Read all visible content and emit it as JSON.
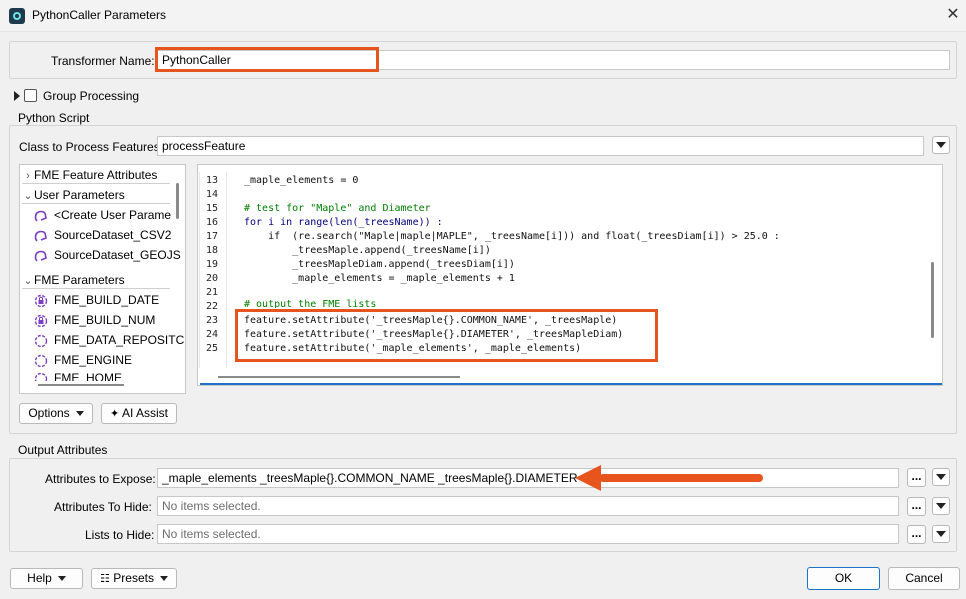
{
  "window": {
    "title": "PythonCaller Parameters"
  },
  "transformer": {
    "label": "Transformer Name:",
    "value": "PythonCaller"
  },
  "group_processing": {
    "label": "Group Processing",
    "checked": false
  },
  "python_script": {
    "title": "Python Script",
    "class_label": "Class to Process Features:",
    "class_value": "processFeature",
    "tree": {
      "sections": [
        {
          "label": "FME Feature Attributes",
          "expanded": false
        },
        {
          "label": "User Parameters",
          "expanded": true,
          "items": [
            "<Create User Parame",
            "SourceDataset_CSV2",
            "SourceDataset_GEOJS"
          ]
        },
        {
          "label": "FME Parameters",
          "expanded": true,
          "items": [
            "FME_BUILD_DATE",
            "FME_BUILD_NUM",
            "FME_DATA_REPOSITC",
            "FME_ENGINE",
            "FME_HOME"
          ]
        }
      ]
    },
    "code": {
      "lines": [
        {
          "n": "13",
          "text": "_maple_elements = 0"
        },
        {
          "n": "14",
          "text": ""
        },
        {
          "n": "15",
          "text": "# test for \"Maple\" and Diameter"
        },
        {
          "n": "16",
          "text": "for i in range(len(_treesName)) :"
        },
        {
          "n": "17",
          "text": "    if  (re.search(\"Maple|maple|MAPLE\", _treesName[i])) and float(_treesDiam[i]) > 25.0 :"
        },
        {
          "n": "18",
          "text": "        _treesMaple.append(_treesName[i])"
        },
        {
          "n": "19",
          "text": "        _treesMapleDiam.append(_treesDiam[i])"
        },
        {
          "n": "20",
          "text": "        _maple_elements = _maple_elements + 1"
        },
        {
          "n": "21",
          "text": ""
        },
        {
          "n": "22",
          "text": "# output the FME lists"
        },
        {
          "n": "23",
          "text": "feature.setAttribute('_treesMaple{}.COMMON_NAME', _treesMaple)"
        },
        {
          "n": "24",
          "text": "feature.setAttribute('_treesMaple{}.DIAMETER', _treesMapleDiam)"
        },
        {
          "n": "25",
          "text": "feature.setAttribute('_maple_elements', _maple_elements)"
        }
      ]
    },
    "options_label": "Options",
    "ai_assist_label": "AI Assist"
  },
  "output_attributes": {
    "title": "Output Attributes",
    "expose_label": "Attributes to Expose:",
    "expose_value": "_maple_elements _treesMaple{}.COMMON_NAME _treesMaple{}.DIAMETER",
    "hide_label": "Attributes To Hide:",
    "hide_placeholder": "No items selected.",
    "lists_label": "Lists to Hide:",
    "lists_placeholder": "No items selected.",
    "ellipsis": "..."
  },
  "footer": {
    "help_label": "Help",
    "presets_label": "Presets",
    "ok_label": "OK",
    "cancel_label": "Cancel"
  },
  "colors": {
    "highlight": "#e8541e",
    "accent": "#1a73c9",
    "param_icon": "#7b3fc4"
  },
  "icons": [
    "python-caller-icon",
    "close-icon",
    "expand-triangle-icon",
    "chevron-right-icon",
    "chevron-down-icon",
    "user-parameter-icon",
    "lock-parameter-icon",
    "dropdown-arrow-icon",
    "sparkle-icon",
    "presets-icon",
    "arrow-icon"
  ]
}
